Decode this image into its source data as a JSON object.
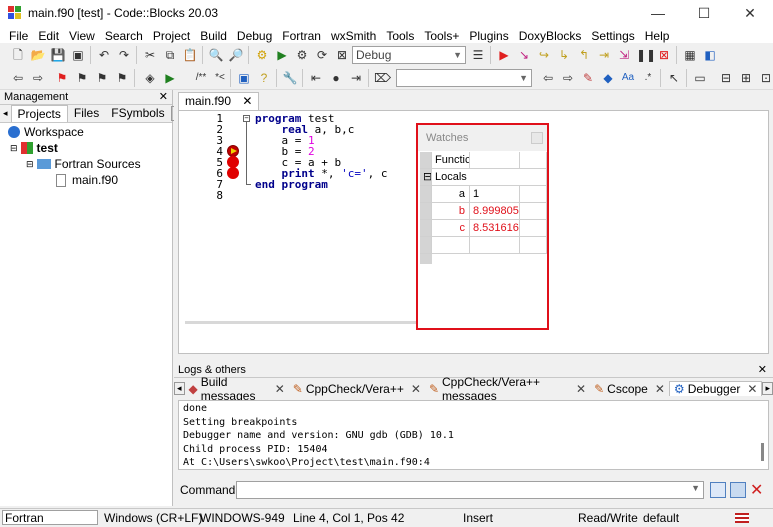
{
  "window": {
    "title": "main.f90 [test] - Code::Blocks 20.03",
    "minimize": "—",
    "maximize": "☐",
    "close": "✕"
  },
  "menu": [
    "File",
    "Edit",
    "View",
    "Search",
    "Project",
    "Build",
    "Debug",
    "Fortran",
    "wxSmith",
    "Tools",
    "Tools+",
    "Plugins",
    "DoxyBlocks",
    "Settings",
    "Help"
  ],
  "toolbar": {
    "build_target": "Debug",
    "search_value": ""
  },
  "management": {
    "title": "Management",
    "tabs": [
      "Projects",
      "Files",
      "FSymbols"
    ],
    "tree": {
      "workspace": "Workspace",
      "project": "test",
      "folder": "Fortran Sources",
      "file": "main.f90"
    }
  },
  "editor": {
    "tab_label": "main.f90",
    "line_numbers": [
      "1",
      "2",
      "3",
      "4",
      "5",
      "6",
      "7",
      "8"
    ],
    "lines": [
      {
        "kw": "program",
        "rest": " test"
      },
      {
        "indent": "    ",
        "kw": "real",
        "rest": " a, b,c"
      },
      {
        "indent": "    ",
        "pre": "a = ",
        "num": "1"
      },
      {
        "indent": "    ",
        "pre": "b = ",
        "num": "2"
      },
      {
        "indent": "    ",
        "pre": "c = a + b"
      },
      {
        "indent": "    ",
        "kw": "print",
        "rest": " *, ",
        "str": "'c='",
        "post": ", c"
      },
      {
        "kw": "end program",
        "rest": ""
      },
      {
        "rest": ""
      }
    ],
    "current_line": 4,
    "breakpoint_lines": [
      5,
      6
    ]
  },
  "watches": {
    "title": "Watches",
    "header": "Functic",
    "group": "Locals",
    "vars": [
      {
        "name": "a",
        "value": "1",
        "changed": false
      },
      {
        "name": "b",
        "value": "8.999805",
        "changed": true
      },
      {
        "name": "c",
        "value": "8.531616",
        "changed": true
      }
    ]
  },
  "logs": {
    "title": "Logs & others",
    "tabs": [
      "Build messages",
      "CppCheck/Vera++",
      "CppCheck/Vera++ messages",
      "Cscope",
      "Debugger"
    ],
    "lines": [
      "done",
      "Setting breakpoints",
      "Debugger name and version: GNU gdb (GDB) 10.1",
      "Child process PID: 15404",
      "At C:\\Users\\swkoo\\Project\\test\\main.f90:4"
    ],
    "command_label": "Command:",
    "command_value": ""
  },
  "status": {
    "language": "Fortran",
    "eol": "Windows (CR+LF)",
    "encoding": "WINDOWS-949",
    "position": "Line 4, Col 1, Pos 42",
    "mode": "Insert",
    "access": "Read/Write",
    "profile": "default"
  },
  "colors": {
    "highlight_border": "#e0101a",
    "changed_value": "#e0101a",
    "keyword": "#00008b",
    "number": "#e000e0"
  }
}
